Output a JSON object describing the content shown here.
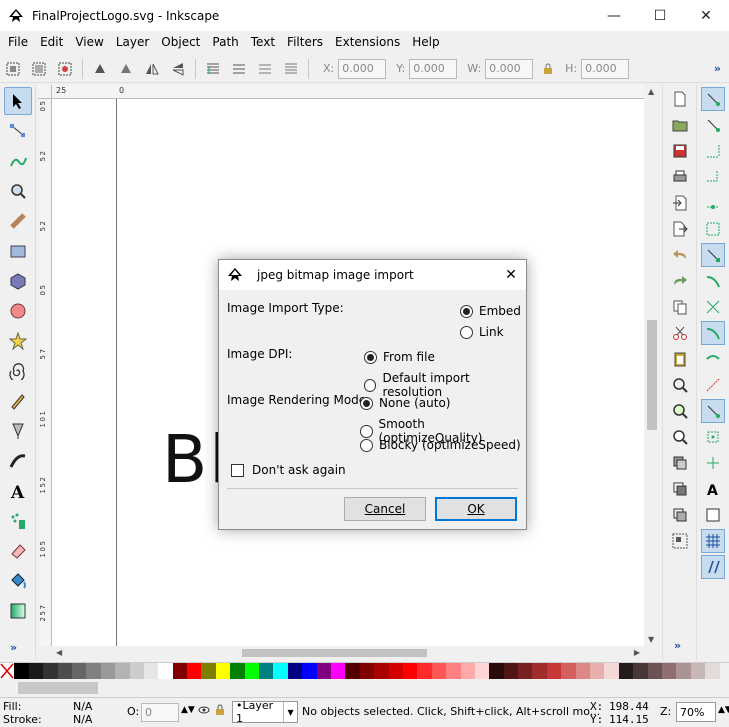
{
  "window": {
    "title": "FinalProjectLogo.svg - Inkscape",
    "minimize": "—",
    "maximize": "☐",
    "close": "✕"
  },
  "menu": [
    "File",
    "Edit",
    "View",
    "Layer",
    "Object",
    "Path",
    "Text",
    "Filters",
    "Extensions",
    "Help"
  ],
  "toolbar": {
    "x_label": "X:",
    "x_value": "0.000",
    "y_label": "Y:",
    "y_value": "0.000",
    "w_label": "W:",
    "w_value": "0.000",
    "h_label": "H:",
    "h_value": "0.000",
    "more": "»"
  },
  "ruler": {
    "top_ticks": [
      "25",
      "0"
    ],
    "left_ticks": [
      "5",
      "0",
      "2",
      "5",
      "2",
      "5",
      "5",
      "0",
      "7",
      "5",
      "1",
      "0",
      "1",
      "2",
      "5",
      "1",
      "5",
      "0",
      "1",
      "7",
      "5",
      "2",
      "0",
      "0",
      "2",
      "2",
      "5"
    ]
  },
  "canvas": {
    "visible_text": "Bl"
  },
  "toolbox_more": "»",
  "rpanel_more": "»",
  "dialog": {
    "title": "jpeg bitmap image import",
    "close": "✕",
    "import_type_label": "Image Import Type:",
    "import_type_options": [
      {
        "label": "Embed",
        "selected": true
      },
      {
        "label": "Link",
        "selected": false
      }
    ],
    "dpi_label": "Image DPI:",
    "dpi_options": [
      {
        "label": "From file",
        "selected": true
      },
      {
        "label": "Default import resolution",
        "selected": false
      }
    ],
    "rendering_label": "Image Rendering Mode:",
    "rendering_options": [
      {
        "label": "None (auto)",
        "selected": true
      },
      {
        "label": "Smooth (optimizeQuality)",
        "selected": false
      },
      {
        "label": "Blocky (optimizeSpeed)",
        "selected": false
      }
    ],
    "dont_ask_label": "Don't ask again",
    "cancel_label": "Cancel",
    "ok_label": "OK"
  },
  "palette": [
    "#000000",
    "#1a1a1a",
    "#333333",
    "#4d4d4d",
    "#666666",
    "#808080",
    "#999999",
    "#b3b3b3",
    "#cccccc",
    "#e6e6e6",
    "#ffffff",
    "#800000",
    "#ff0000",
    "#808000",
    "#ffff00",
    "#008000",
    "#00ff00",
    "#008080",
    "#00ffff",
    "#000080",
    "#0000ff",
    "#800080",
    "#ff00ff",
    "#550000",
    "#800000",
    "#aa0000",
    "#d40000",
    "#ff0000",
    "#ff2a2a",
    "#ff5555",
    "#ff8080",
    "#ffaaaa",
    "#ffd5d5",
    "#280b0b",
    "#501616",
    "#782121",
    "#a02c2c",
    "#c83737",
    "#d35f5f",
    "#de8787",
    "#e9afaf",
    "#f4d7d7",
    "#241c1c",
    "#483737",
    "#6c5353",
    "#916f6f",
    "#ac9393",
    "#c8b7b7",
    "#e3dbdb"
  ],
  "status": {
    "fill_label": "Fill:",
    "fill_value": "N/A",
    "stroke_label": "Stroke:",
    "stroke_value": "N/A",
    "opacity_label": "O:",
    "opacity_value": "0",
    "layer_name": "•Layer 1",
    "message": "No objects selected. Click, Shift+click, Alt+scroll mo...",
    "x_label": "X:",
    "x_value": "198.44",
    "y_label": "Y:",
    "y_value": "114.15",
    "zoom_label": "Z:",
    "zoom_value": "70%"
  }
}
